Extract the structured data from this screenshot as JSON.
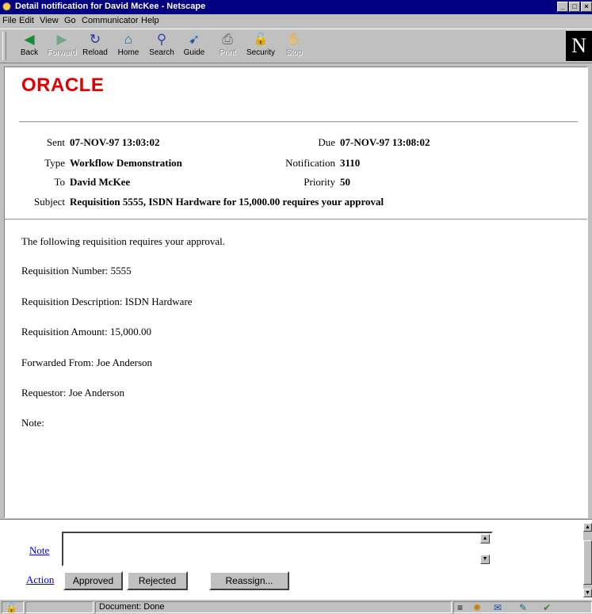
{
  "window": {
    "title": "Detail notification for David McKee - Netscape",
    "controls": [
      "_",
      "□",
      "×"
    ]
  },
  "menu": {
    "items": [
      {
        "label": "File"
      },
      {
        "label": "Edit"
      },
      {
        "label": "View"
      },
      {
        "label": "Go"
      },
      {
        "label": "Communicator"
      },
      {
        "label": "Help"
      }
    ]
  },
  "toolbar": {
    "buttons": [
      {
        "label": "Back",
        "icon": "back-arrow-icon",
        "glyph": "◀",
        "enabled": true
      },
      {
        "label": "Forward",
        "icon": "forward-arrow-icon",
        "glyph": "▶",
        "enabled": false
      },
      {
        "label": "Reload",
        "icon": "reload-icon",
        "glyph": "↻",
        "enabled": true
      },
      {
        "label": "Home",
        "icon": "home-icon",
        "glyph": "⌂",
        "enabled": true
      },
      {
        "label": "Search",
        "icon": "search-icon",
        "glyph": "⚲",
        "enabled": true
      },
      {
        "label": "Guide",
        "icon": "guide-icon",
        "glyph": "➹",
        "enabled": true
      },
      {
        "label": "Print",
        "icon": "print-icon",
        "glyph": "⎙",
        "enabled": false
      },
      {
        "label": "Security",
        "icon": "lock-icon",
        "glyph": "🔓",
        "enabled": true
      },
      {
        "label": "Stop",
        "icon": "stop-icon",
        "glyph": "✋",
        "enabled": false
      }
    ],
    "logo": "N"
  },
  "page": {
    "logo": "ORACLE",
    "header": {
      "sent_label": "Sent",
      "sent_value": "07-NOV-97 13:03:02",
      "due_label": "Due",
      "due_value": "07-NOV-97 13:08:02",
      "type_label": "Type",
      "type_value": "Workflow Demonstration",
      "notification_label": "Notification",
      "notification_value": "3110",
      "to_label": "To",
      "to_value": "David McKee",
      "priority_label": "Priority",
      "priority_value": "50",
      "subject_label": "Subject",
      "subject_value": "Requisition 5555, ISDN Hardware for 15,000.00 requires your approval"
    },
    "body": {
      "intro": "The following requisition requires your approval.",
      "req_number": "Requisition Number: 5555",
      "req_description": "Requisition Description: ISDN Hardware",
      "req_amount": "Requisition Amount: 15,000.00",
      "forwarded_from": "Forwarded From: Joe Anderson",
      "requestor": "Requestor: Joe Anderson",
      "note": "Note:"
    }
  },
  "response": {
    "note_link": "Note",
    "note_value": "",
    "action_link": "Action",
    "approved_button": "Approved",
    "rejected_button": "Rejected",
    "reassign_button": "Reassign..."
  },
  "status": {
    "text": "Document: Done"
  },
  "colors": {
    "title_bar": "#000080",
    "oracle_red": "#e00000",
    "link": "#0000ee"
  }
}
